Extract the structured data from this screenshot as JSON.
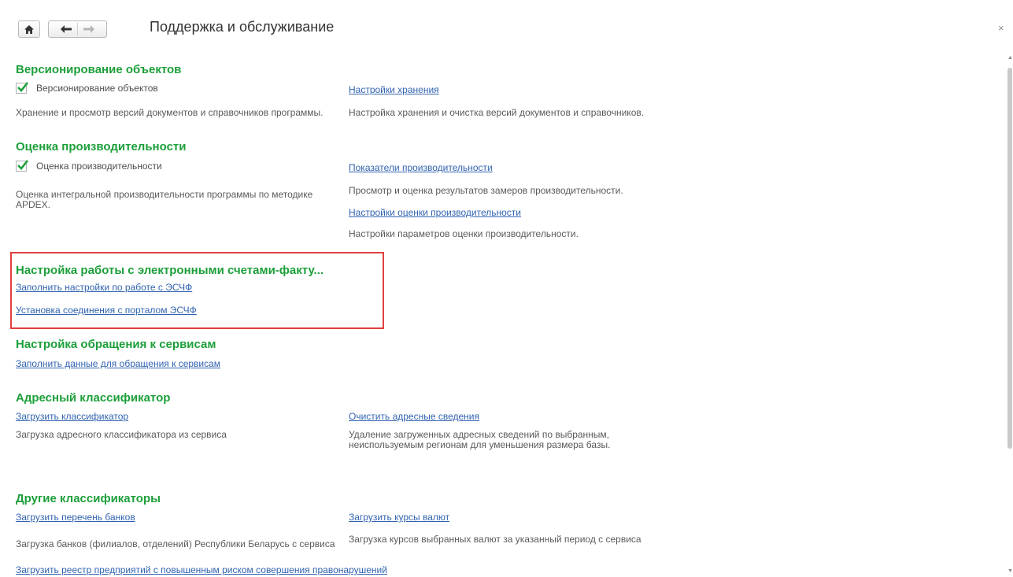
{
  "window": {
    "title": "Поддержка и обслуживание",
    "close": "×"
  },
  "sections": {
    "versioning": {
      "heading": "Версионирование объектов",
      "checkbox_label": "Версионирование объектов",
      "checkbox_checked": true,
      "description": "Хранение и просмотр версий документов и справочников программы.",
      "link": "Настройки хранения",
      "link_description": "Настройка хранения и очистка версий документов и справочников."
    },
    "performance": {
      "heading": "Оценка производительности",
      "checkbox_label": "Оценка производительности",
      "checkbox_checked": true,
      "description": "Оценка интегральной производительности программы по методике APDEX.",
      "link1": "Показатели производительности",
      "link1_description": "Просмотр и оценка результатов замеров производительности.",
      "link2": "Настройки оценки производительности",
      "link2_description": "Настройки параметров оценки производительности."
    },
    "esf": {
      "heading": "Настройка работы с электронными счетами-факту...",
      "link1": "Заполнить настройки по работе с ЭСЧФ",
      "link2": "Установка соединения с порталом ЭСЧФ"
    },
    "services": {
      "heading": "Настройка обращения к сервисам",
      "link": "Заполнить данные для обращения к сервисам"
    },
    "address": {
      "heading": "Адресный классификатор",
      "link_left": "Загрузить классификатор",
      "desc_left": "Загрузка адресного классификатора из сервиса",
      "link_right": "Очистить адресные сведения",
      "desc_right": "Удаление загруженных адресных сведений по выбранным, неиспользуемым регионам для уменьшения размера базы."
    },
    "other": {
      "heading": "Другие классификаторы",
      "link_left": "Загрузить перечень банков",
      "desc_left": "Загрузка банков (филиалов, отделений) Республики Беларусь с сервиса",
      "link_right": "Загрузить курсы валют",
      "desc_right": "Загрузка курсов выбранных валют за указанный период с сервиса",
      "link_bottom": "Загрузить реестр предприятий с повышенным риском совершения правонарушений"
    }
  },
  "colors": {
    "heading": "#1c9f3a",
    "link": "#3163b0",
    "highlight": "#e04040"
  }
}
